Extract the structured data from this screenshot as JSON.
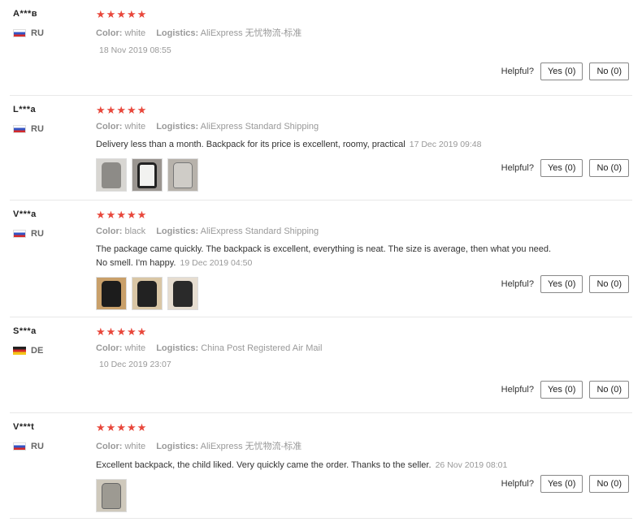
{
  "helpful_label": "Helpful?",
  "reviews": [
    {
      "user": "A***в",
      "country": "RU",
      "flag": "ru",
      "color_label": "Color:",
      "color": "white",
      "logistics_label": "Logistics:",
      "logistics": "AliExpress 无忧物流-标准",
      "text": "",
      "date": "18 Nov 2019 08:55",
      "yes": "Yes (0)",
      "no": "No (0)"
    },
    {
      "user": "L***a",
      "country": "RU",
      "flag": "ru",
      "color_label": "Color:",
      "color": "white",
      "logistics_label": "Logistics:",
      "logistics": "AliExpress Standard Shipping",
      "text": "Delivery less than a month. Backpack for its price is excellent, roomy, practical",
      "date": "17 Dec 2019 09:48",
      "yes": "Yes (0)",
      "no": "No (0)"
    },
    {
      "user": "V***a",
      "country": "RU",
      "flag": "ru",
      "color_label": "Color:",
      "color": "black",
      "logistics_label": "Logistics:",
      "logistics": "AliExpress Standard Shipping",
      "text": "The package came quickly. The backpack is excellent, everything is neat. The size is average, then what you need. No smell. I'm happy.",
      "date": "19 Dec 2019 04:50",
      "yes": "Yes (0)",
      "no": "No (0)"
    },
    {
      "user": "S***a",
      "country": "DE",
      "flag": "de",
      "color_label": "Color:",
      "color": "white",
      "logistics_label": "Logistics:",
      "logistics": "China Post Registered Air Mail",
      "text": "",
      "date": "10 Dec 2019 23:07",
      "yes": "Yes (0)",
      "no": "No (0)"
    },
    {
      "user": "V***t",
      "country": "RU",
      "flag": "ru",
      "color_label": "Color:",
      "color": "white",
      "logistics_label": "Logistics:",
      "logistics": "AliExpress 无忧物流-标准",
      "text": "Excellent backpack, the child liked. Very quickly came the order. Thanks to the seller.",
      "date": "26 Nov 2019 08:01",
      "yes": "Yes (0)",
      "no": "No (0)"
    }
  ]
}
